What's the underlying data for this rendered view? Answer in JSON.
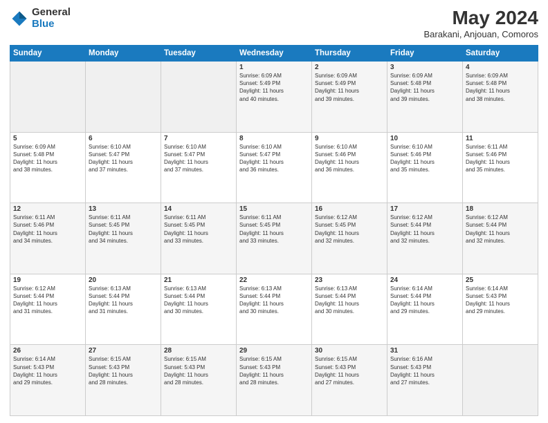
{
  "logo": {
    "general": "General",
    "blue": "Blue"
  },
  "header": {
    "title": "May 2024",
    "location": "Barakani, Anjouan, Comoros"
  },
  "days": [
    "Sunday",
    "Monday",
    "Tuesday",
    "Wednesday",
    "Thursday",
    "Friday",
    "Saturday"
  ],
  "weeks": [
    [
      {
        "num": "",
        "info": ""
      },
      {
        "num": "",
        "info": ""
      },
      {
        "num": "",
        "info": ""
      },
      {
        "num": "1",
        "info": "Sunrise: 6:09 AM\nSunset: 5:49 PM\nDaylight: 11 hours\nand 40 minutes."
      },
      {
        "num": "2",
        "info": "Sunrise: 6:09 AM\nSunset: 5:49 PM\nDaylight: 11 hours\nand 39 minutes."
      },
      {
        "num": "3",
        "info": "Sunrise: 6:09 AM\nSunset: 5:48 PM\nDaylight: 11 hours\nand 39 minutes."
      },
      {
        "num": "4",
        "info": "Sunrise: 6:09 AM\nSunset: 5:48 PM\nDaylight: 11 hours\nand 38 minutes."
      }
    ],
    [
      {
        "num": "5",
        "info": "Sunrise: 6:09 AM\nSunset: 5:48 PM\nDaylight: 11 hours\nand 38 minutes."
      },
      {
        "num": "6",
        "info": "Sunrise: 6:10 AM\nSunset: 5:47 PM\nDaylight: 11 hours\nand 37 minutes."
      },
      {
        "num": "7",
        "info": "Sunrise: 6:10 AM\nSunset: 5:47 PM\nDaylight: 11 hours\nand 37 minutes."
      },
      {
        "num": "8",
        "info": "Sunrise: 6:10 AM\nSunset: 5:47 PM\nDaylight: 11 hours\nand 36 minutes."
      },
      {
        "num": "9",
        "info": "Sunrise: 6:10 AM\nSunset: 5:46 PM\nDaylight: 11 hours\nand 36 minutes."
      },
      {
        "num": "10",
        "info": "Sunrise: 6:10 AM\nSunset: 5:46 PM\nDaylight: 11 hours\nand 35 minutes."
      },
      {
        "num": "11",
        "info": "Sunrise: 6:11 AM\nSunset: 5:46 PM\nDaylight: 11 hours\nand 35 minutes."
      }
    ],
    [
      {
        "num": "12",
        "info": "Sunrise: 6:11 AM\nSunset: 5:46 PM\nDaylight: 11 hours\nand 34 minutes."
      },
      {
        "num": "13",
        "info": "Sunrise: 6:11 AM\nSunset: 5:45 PM\nDaylight: 11 hours\nand 34 minutes."
      },
      {
        "num": "14",
        "info": "Sunrise: 6:11 AM\nSunset: 5:45 PM\nDaylight: 11 hours\nand 33 minutes."
      },
      {
        "num": "15",
        "info": "Sunrise: 6:11 AM\nSunset: 5:45 PM\nDaylight: 11 hours\nand 33 minutes."
      },
      {
        "num": "16",
        "info": "Sunrise: 6:12 AM\nSunset: 5:45 PM\nDaylight: 11 hours\nand 32 minutes."
      },
      {
        "num": "17",
        "info": "Sunrise: 6:12 AM\nSunset: 5:44 PM\nDaylight: 11 hours\nand 32 minutes."
      },
      {
        "num": "18",
        "info": "Sunrise: 6:12 AM\nSunset: 5:44 PM\nDaylight: 11 hours\nand 32 minutes."
      }
    ],
    [
      {
        "num": "19",
        "info": "Sunrise: 6:12 AM\nSunset: 5:44 PM\nDaylight: 11 hours\nand 31 minutes."
      },
      {
        "num": "20",
        "info": "Sunrise: 6:13 AM\nSunset: 5:44 PM\nDaylight: 11 hours\nand 31 minutes."
      },
      {
        "num": "21",
        "info": "Sunrise: 6:13 AM\nSunset: 5:44 PM\nDaylight: 11 hours\nand 30 minutes."
      },
      {
        "num": "22",
        "info": "Sunrise: 6:13 AM\nSunset: 5:44 PM\nDaylight: 11 hours\nand 30 minutes."
      },
      {
        "num": "23",
        "info": "Sunrise: 6:13 AM\nSunset: 5:44 PM\nDaylight: 11 hours\nand 30 minutes."
      },
      {
        "num": "24",
        "info": "Sunrise: 6:14 AM\nSunset: 5:44 PM\nDaylight: 11 hours\nand 29 minutes."
      },
      {
        "num": "25",
        "info": "Sunrise: 6:14 AM\nSunset: 5:43 PM\nDaylight: 11 hours\nand 29 minutes."
      }
    ],
    [
      {
        "num": "26",
        "info": "Sunrise: 6:14 AM\nSunset: 5:43 PM\nDaylight: 11 hours\nand 29 minutes."
      },
      {
        "num": "27",
        "info": "Sunrise: 6:15 AM\nSunset: 5:43 PM\nDaylight: 11 hours\nand 28 minutes."
      },
      {
        "num": "28",
        "info": "Sunrise: 6:15 AM\nSunset: 5:43 PM\nDaylight: 11 hours\nand 28 minutes."
      },
      {
        "num": "29",
        "info": "Sunrise: 6:15 AM\nSunset: 5:43 PM\nDaylight: 11 hours\nand 28 minutes."
      },
      {
        "num": "30",
        "info": "Sunrise: 6:15 AM\nSunset: 5:43 PM\nDaylight: 11 hours\nand 27 minutes."
      },
      {
        "num": "31",
        "info": "Sunrise: 6:16 AM\nSunset: 5:43 PM\nDaylight: 11 hours\nand 27 minutes."
      },
      {
        "num": "",
        "info": ""
      }
    ]
  ]
}
